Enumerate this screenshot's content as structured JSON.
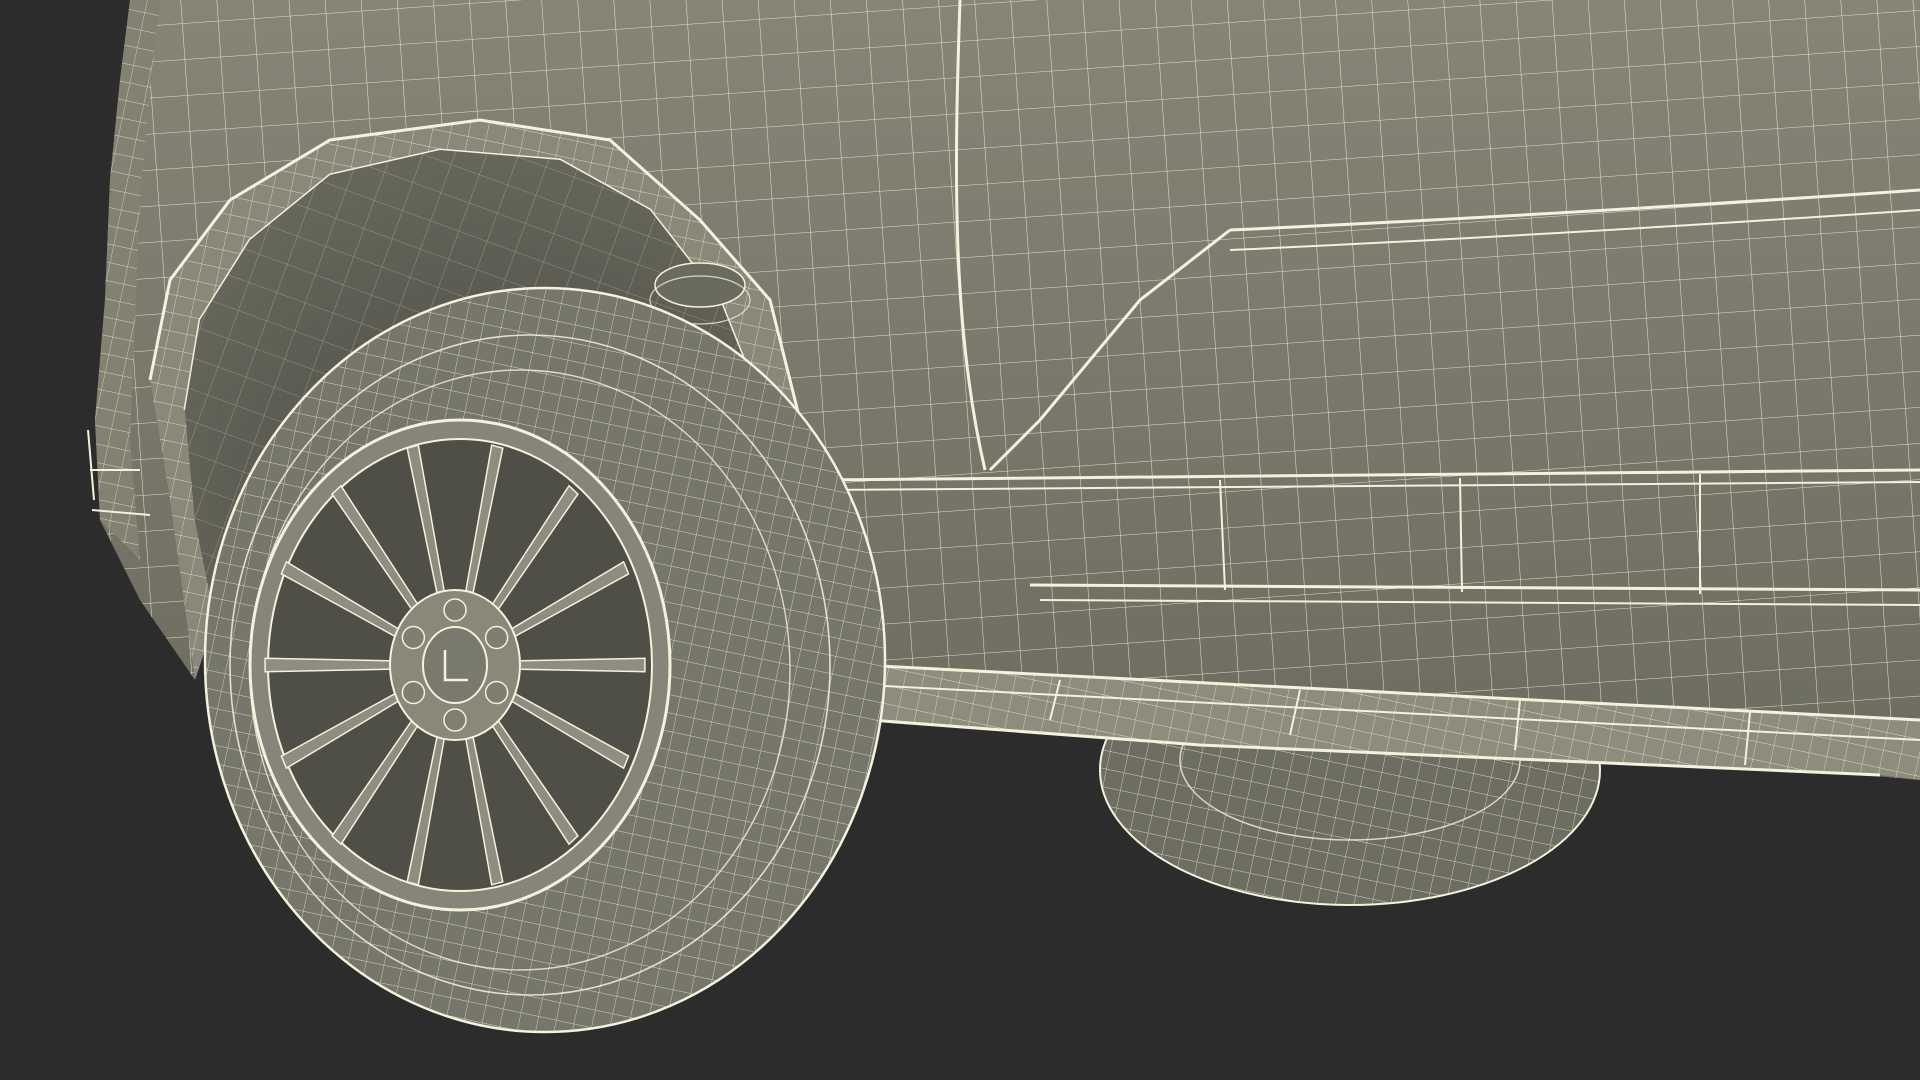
{
  "scene": {
    "subject": "wireframe-suv-front-wheel",
    "colors": {
      "background": "#2c2c2c",
      "body_fill": "#7f7e6f",
      "body_shade": "#6f6e61",
      "wheel_well": "#5a5a50",
      "tire_fill": "#77766a",
      "rim_fill": "#86857a",
      "wire": "#f3f2dc"
    }
  }
}
